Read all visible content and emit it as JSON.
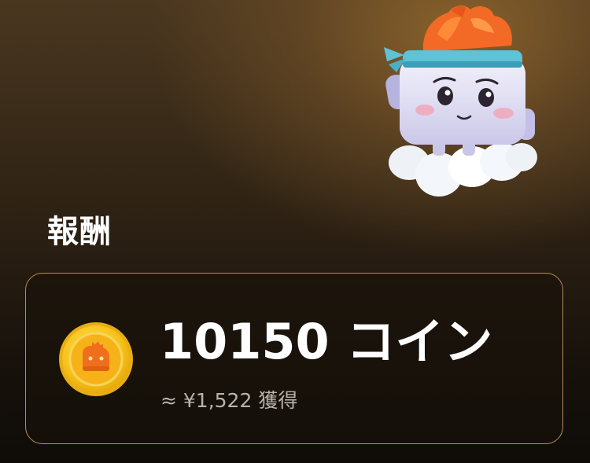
{
  "section": {
    "title": "報酬"
  },
  "reward": {
    "amount": "10150 コイン",
    "approx": "≈ ¥1,522 獲得"
  },
  "icons": {
    "mascot": "mascot-illustration",
    "coin": "coin-icon"
  },
  "colors": {
    "card_border": "#b48e56",
    "coin_gold": "#f5c21b",
    "coin_orange": "#f08a1c"
  }
}
